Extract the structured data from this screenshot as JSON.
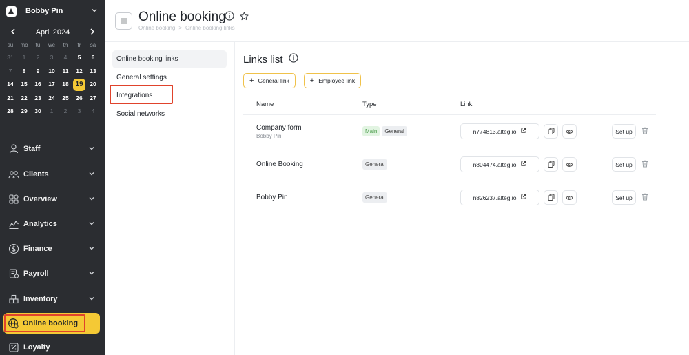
{
  "sidebar": {
    "account_name": "Bobby Pin",
    "calendar": {
      "month": "April 2024",
      "weekdays": [
        "su",
        "mo",
        "tu",
        "we",
        "th",
        "fr",
        "sa"
      ],
      "days": [
        {
          "d": "31",
          "m": true
        },
        {
          "d": "1",
          "m": true
        },
        {
          "d": "2",
          "m": true
        },
        {
          "d": "3",
          "m": true
        },
        {
          "d": "4",
          "m": true
        },
        {
          "d": "5",
          "m": false
        },
        {
          "d": "6",
          "m": false
        },
        {
          "d": "7",
          "m": true
        },
        {
          "d": "8",
          "m": false
        },
        {
          "d": "9",
          "m": false
        },
        {
          "d": "10",
          "m": false
        },
        {
          "d": "11",
          "m": false
        },
        {
          "d": "12",
          "m": false
        },
        {
          "d": "13",
          "m": false
        },
        {
          "d": "14",
          "m": false
        },
        {
          "d": "15",
          "m": false
        },
        {
          "d": "16",
          "m": false
        },
        {
          "d": "17",
          "m": false
        },
        {
          "d": "18",
          "m": false
        },
        {
          "d": "19",
          "m": false,
          "today": true
        },
        {
          "d": "20",
          "m": false
        },
        {
          "d": "21",
          "m": false
        },
        {
          "d": "22",
          "m": false
        },
        {
          "d": "23",
          "m": false
        },
        {
          "d": "24",
          "m": false
        },
        {
          "d": "25",
          "m": false
        },
        {
          "d": "26",
          "m": false
        },
        {
          "d": "27",
          "m": false
        },
        {
          "d": "28",
          "m": false
        },
        {
          "d": "29",
          "m": false
        },
        {
          "d": "30",
          "m": false
        },
        {
          "d": "1",
          "m": true
        },
        {
          "d": "2",
          "m": true
        },
        {
          "d": "3",
          "m": true
        },
        {
          "d": "4",
          "m": true
        }
      ]
    },
    "nav": [
      {
        "label": "Staff",
        "icon": "user-icon"
      },
      {
        "label": "Clients",
        "icon": "users-icon"
      },
      {
        "label": "Overview",
        "icon": "grid-icon"
      },
      {
        "label": "Analytics",
        "icon": "chart-line-icon"
      },
      {
        "label": "Finance",
        "icon": "dollar-icon"
      },
      {
        "label": "Payroll",
        "icon": "payroll-icon"
      },
      {
        "label": "Inventory",
        "icon": "boxes-icon"
      },
      {
        "label": "Online booking",
        "icon": "globe-icon",
        "active": true
      },
      {
        "label": "Loyalty",
        "icon": "loyalty-icon"
      }
    ]
  },
  "header": {
    "title": "Online booking",
    "breadcrumb": [
      "Online booking",
      "Online booking links"
    ]
  },
  "submenu": [
    {
      "label": "Online booking links",
      "active": true
    },
    {
      "label": "General settings"
    },
    {
      "label": "Integrations"
    },
    {
      "label": "Social networks"
    }
  ],
  "main": {
    "title": "Links list",
    "buttons": {
      "general_link": "General link",
      "employee_link": "Employee link"
    },
    "columns": {
      "name": "Name",
      "type": "Type",
      "link": "Link"
    },
    "rows": [
      {
        "name": "Company form",
        "subname": "Bobby Pin",
        "badges": [
          "Main",
          "General"
        ],
        "link": "n774813.alteg.io",
        "setup": "Set up"
      },
      {
        "name": "Online Booking",
        "subname": "",
        "badges": [
          "General"
        ],
        "link": "n804474.alteg.io",
        "setup": "Set up"
      },
      {
        "name": "Bobby Pin",
        "subname": "",
        "badges": [
          "General"
        ],
        "link": "n826237.alteg.io",
        "setup": "Set up"
      }
    ]
  },
  "colors": {
    "accent": "#f5c935",
    "sidebar_bg": "#2b2d31",
    "highlight": "#e0432c"
  }
}
